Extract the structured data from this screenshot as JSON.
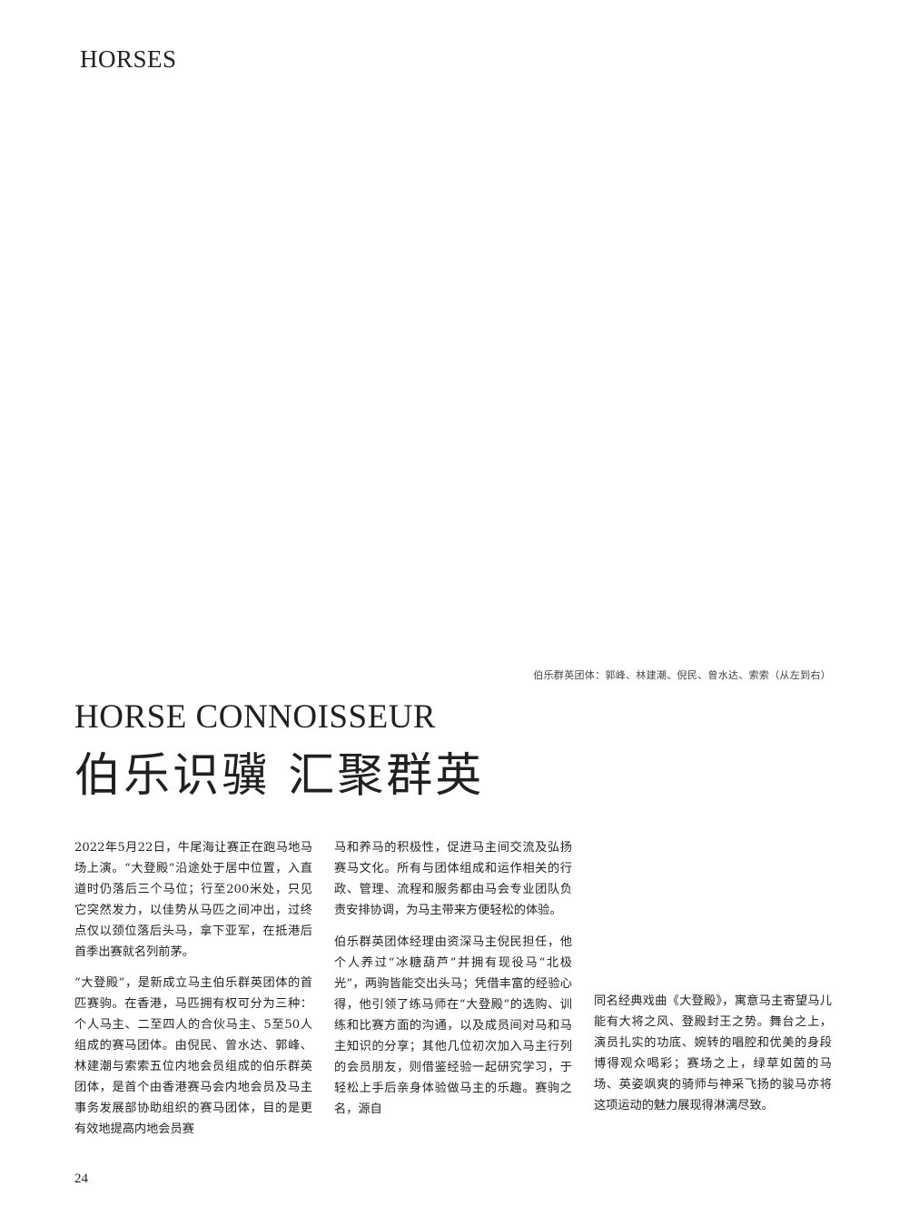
{
  "header": {
    "section": "HORSES"
  },
  "photo": {
    "caption": "伯乐群英团体：郭峰、林建潮、倪民、曾水达、索索（从左到右）"
  },
  "article": {
    "title_en": "HORSE CONNOISSEUR",
    "title_cn": "伯乐识骥 汇聚群英",
    "columns": [
      {
        "paragraphs": [
          "2022年5月22日，牛尾海让赛正在跑马地马场上演。“大登殿”沿途处于居中位置，入直道时仍落后三个马位；行至200米处，只见它突然发力，以佳势从马匹之间冲出，过终点仅以颈位落后头马，拿下亚军，在抵港后首季出赛就名列前茅。",
          "“大登殿”，是新成立马主伯乐群英团体的首匹赛驹。在香港，马匹拥有权可分为三种：个人马主、二至四人的合伙马主、5至50人组成的赛马团体。由倪民、曾水达、郭峰、林建潮与索索五位内地会员组成的伯乐群英团体，是首个由香港赛马会内地会员及马主事务发展部协助组织的赛马团体，目的是更有效地提高内地会员赛"
        ]
      },
      {
        "paragraphs": [
          "马和养马的积极性，促进马主间交流及弘扬赛马文化。所有与团体组成和运作相关的行政、管理、流程和服务都由马会专业团队负责安排协调，为马主带来方便轻松的体验。",
          "伯乐群英团体经理由资深马主倪民担任，他个人养过“冰糖葫芦”并拥有现役马“北极光”，两驹皆能交出头马；凭借丰富的经验心得，他引领了练马师在“大登殿”的选购、训练和比赛方面的沟通，以及成员间对马和马主知识的分享；其他几位初次加入马主行列的会员朋友，则借鉴经验一起研究学习，于轻松上手后亲身体验做马主的乐趣。赛驹之名，源自"
        ]
      },
      {
        "paragraphs": [
          "同名经典戏曲《大登殿》，寓意马主寄望马儿能有大将之风、登殿封王之势。舞台之上，演员扎实的功底、婉转的唱腔和优美的身段博得观众喝彩；赛场之上，绿草如茵的马场、英姿飒爽的骑师与神采飞扬的骏马亦将这项运动的魅力展现得淋漓尽致。"
        ]
      }
    ]
  },
  "footer": {
    "page_number": "24"
  }
}
